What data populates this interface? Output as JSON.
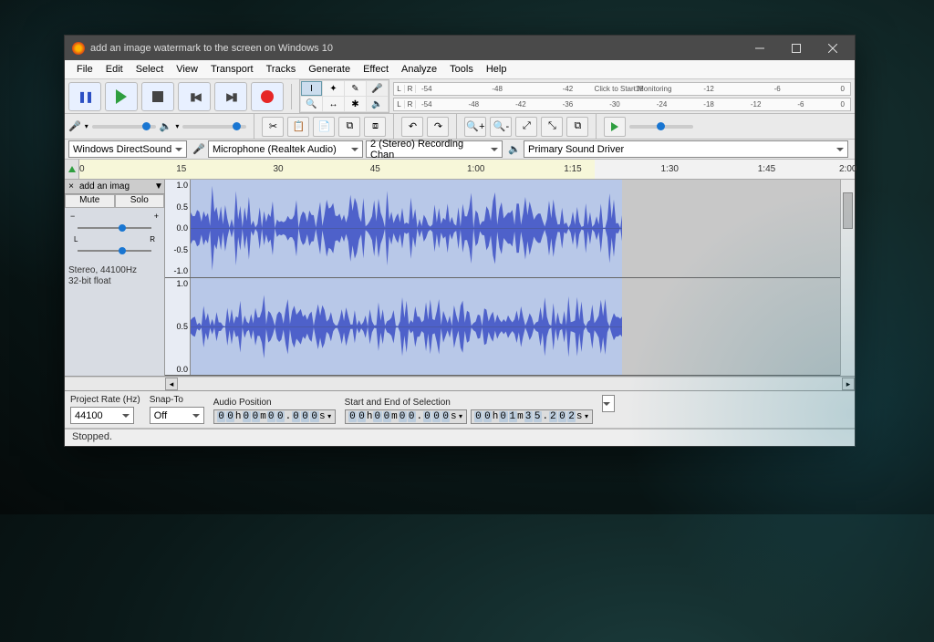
{
  "window": {
    "title": "add an image watermark to the screen on Windows 10"
  },
  "menu": [
    "File",
    "Edit",
    "Select",
    "View",
    "Transport",
    "Tracks",
    "Generate",
    "Effect",
    "Analyze",
    "Tools",
    "Help"
  ],
  "transport": {
    "pause": "Pause",
    "play": "Play",
    "stop": "Stop",
    "skip_start": "Skip to Start",
    "skip_end": "Skip to End",
    "record": "Record"
  },
  "tools": {
    "selection": "I",
    "envelope": "✦",
    "draw": "✎",
    "zoom": "🔍",
    "timeshift": "↔",
    "multi": "✱",
    "mic": "🎤",
    "spk": "🔈"
  },
  "rec_meter": {
    "LR": [
      "L",
      "R"
    ],
    "ticks": [
      "-54",
      "-48",
      "-42",
      ""
    ],
    "message": "Click to Start Monitoring",
    "ticks2": [
      "-18",
      "-12",
      "-6",
      "0"
    ]
  },
  "play_meter": {
    "LR": [
      "L",
      "R"
    ],
    "ticks": [
      "-54",
      "-48",
      "-42",
      "-36",
      "-30",
      "-24",
      "-18",
      "-12",
      "-6",
      "0"
    ]
  },
  "row2": {
    "mic": "🎤",
    "spk": "🔈",
    "cut": "✂",
    "copy": "📋",
    "paste": "📄",
    "trim": "⧉",
    "silence": "⧈",
    "undo": "↶",
    "redo": "↷",
    "zoom_in": "🔍+",
    "zoom_out": "🔍-",
    "zoom_sel": "⤢",
    "zoom_fit": "⤡",
    "zoom_toggle": "⧉",
    "play_at": "Play-at-Speed"
  },
  "devices": {
    "host": "Windows DirectSound",
    "rec_device": "Microphone (Realtek Audio)",
    "rec_channels": "2 (Stereo) Recording Chan",
    "play_device": "Primary Sound Driver"
  },
  "timeline": {
    "ticks": [
      "0",
      "15",
      "30",
      "45",
      "1:00",
      "1:15",
      "1:30",
      "1:45",
      "2:00"
    ]
  },
  "track": {
    "name": "add an imag",
    "mute": "Mute",
    "solo": "Solo",
    "L": "L",
    "R": "R",
    "info1": "Stereo, 44100Hz",
    "info2": "32-bit float",
    "scale": [
      "1.0",
      "0.5",
      "0.0",
      "-0.5",
      "-1.0"
    ],
    "scale2": [
      "1.0",
      "0.5",
      "0.0"
    ]
  },
  "selection": {
    "project_rate_label": "Project Rate (Hz)",
    "project_rate": "44100",
    "snap_label": "Snap-To",
    "snap": "Off",
    "pos_label": "Audio Position",
    "pos": "00h00m00.000s",
    "sel_label": "Start and End of Selection",
    "sel_start": "00h00m00.000s",
    "sel_end": "00h01m35.202s"
  },
  "status": "Stopped."
}
